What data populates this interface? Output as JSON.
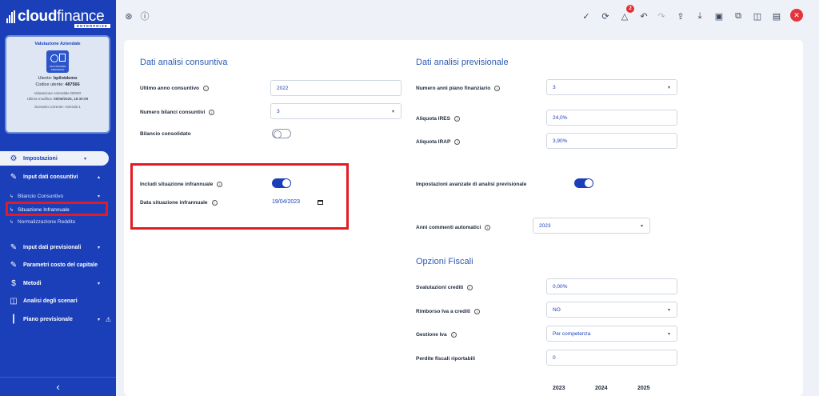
{
  "logo": {
    "brand_bold": "cloud",
    "brand_light": "finance",
    "tagline": "ENTERPRISE"
  },
  "company_card": {
    "title": "Valutazione Aziendale",
    "icon_caption": "VALUTAZIONE AZIENDALE",
    "user_label": "Utente:",
    "user": "bpilotdemo",
    "code_label": "Codice utente:",
    "code": "487566",
    "project": "Valutazione Aziendale DEMO",
    "last_mod_label": "Ultima modifica:",
    "last_mod": "05/06/2025, 18:30:09",
    "scenario": "Scenario corrente: Azienda 1"
  },
  "sidebar": {
    "impostazioni": "Impostazioni",
    "input_consuntivi": "Input dati consuntivi",
    "bilancio_consuntivo": "Bilancio Consuntivo",
    "situazione_infrannuale": "Situazione Infrannuale",
    "normalizzazione_reddito": "Normalizzazione Reddito",
    "input_previsionali": "Input dati previsionali",
    "parametri_costo": "Parametri costo del capitale",
    "metodi": "Metodi",
    "analisi_scenari": "Analisi degli scenari",
    "piano_previsionale": "Piano previsionale"
  },
  "topbar": {
    "alerts_count": "2"
  },
  "consuntiva": {
    "title": "Dati analisi consuntiva",
    "ultimo_anno_label": "Ultimo anno consuntivo",
    "ultimo_anno_value": "2022",
    "numero_bilanci_label": "Numero bilanci consuntivi",
    "numero_bilanci_value": "3",
    "bilancio_consolidato_label": "Bilancio consolidato",
    "includi_infrannuale_label": "Includi situazione infrannuale",
    "data_infrannuale_label": "Data situazione infrannuale",
    "data_infrannuale_value": "19/04/2023"
  },
  "previsionale": {
    "title": "Dati analisi previsionale",
    "numero_anni_label": "Numero anni piano finanziario",
    "numero_anni_value": "3",
    "ires_label": "Aliquota IRES",
    "ires_value": "24,0%",
    "irap_label": "Aliquota IRAP",
    "irap_value": "3,90%",
    "avanzate_label": "Impostazioni avanzate di analisi previsionale",
    "anni_commenti_label": "Anni commenti automatici",
    "anni_commenti_value": "2023"
  },
  "fiscali": {
    "title": "Opzioni Fiscali",
    "svalutazioni_label": "Svalutazioni crediti",
    "svalutazioni_value": "0,00%",
    "rimborso_label": "Rimborso Iva a crediti",
    "rimborso_value": "NO",
    "gestione_label": "Gestione Iva",
    "gestione_value": "Per competenza",
    "perdite_label": "Perdite fiscali riportabili",
    "perdite_value": "0",
    "years": [
      "2023",
      "2024",
      "2025"
    ]
  },
  "colors": {
    "sidebar": "#1a3fb8",
    "accent": "#2c5bb5",
    "highlight": "#e31b23",
    "close": "#e5343a"
  }
}
